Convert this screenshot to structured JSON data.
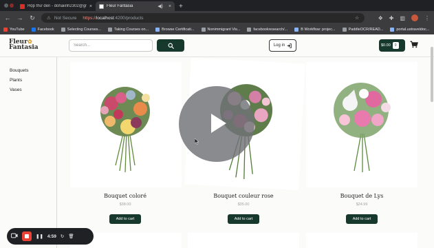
{
  "browser": {
    "tabs": [
      {
        "title": "Hộp thư đến - dohaiinh2302@gmail.com - Gmail"
      },
      {
        "title": "Fleur Fantasia"
      }
    ],
    "address": {
      "security_label": "Not Secure",
      "scheme": "https://",
      "host": "localhost",
      "port": ":4200",
      "path": "/products"
    },
    "bookmarks": [
      {
        "label": "YouTube",
        "icon": "youtube-icon"
      },
      {
        "label": "Facebook",
        "icon": "facebook-icon"
      },
      {
        "label": "Selecting Courses...",
        "icon": "bookmark-icon"
      },
      {
        "label": "Taking Courses on...",
        "icon": "bookmark-icon"
      },
      {
        "label": "Browse Certificati...",
        "icon": "bookmark-icon"
      },
      {
        "label": "Nonimmigrant Vis...",
        "icon": "bookmark-icon"
      },
      {
        "label": "facebookresearch/...",
        "icon": "github-icon"
      },
      {
        "label": "B Workflow: projec...",
        "icon": "bookmark-icon"
      },
      {
        "label": "PaddleOCR/READ...",
        "icon": "github-icon"
      },
      {
        "label": "portal.ustraveldoc...",
        "icon": "bookmark-icon"
      }
    ]
  },
  "site": {
    "logo_line1": "Fleur",
    "logo_line2": "Fantasia",
    "search_placeholder": "Search...",
    "login_label": "Log in",
    "cart_total": "$0.00",
    "cart_count": "0",
    "sidebar": [
      {
        "label": "Bouquets"
      },
      {
        "label": "Plants"
      },
      {
        "label": "Vases"
      }
    ],
    "products": [
      {
        "name": "Bouquet coloré",
        "price": "$38.00",
        "button": "Add to cart"
      },
      {
        "name": "Bouquet couleur rose",
        "price": "$35.00",
        "button": "Add to cart"
      },
      {
        "name": "Bouquet de Lys",
        "price": "$24.99",
        "button": "Add to cart"
      }
    ]
  },
  "recorder": {
    "time": "4:59"
  },
  "colors": {
    "brand_green": "#17392d",
    "recorder_red": "#ea4335"
  }
}
